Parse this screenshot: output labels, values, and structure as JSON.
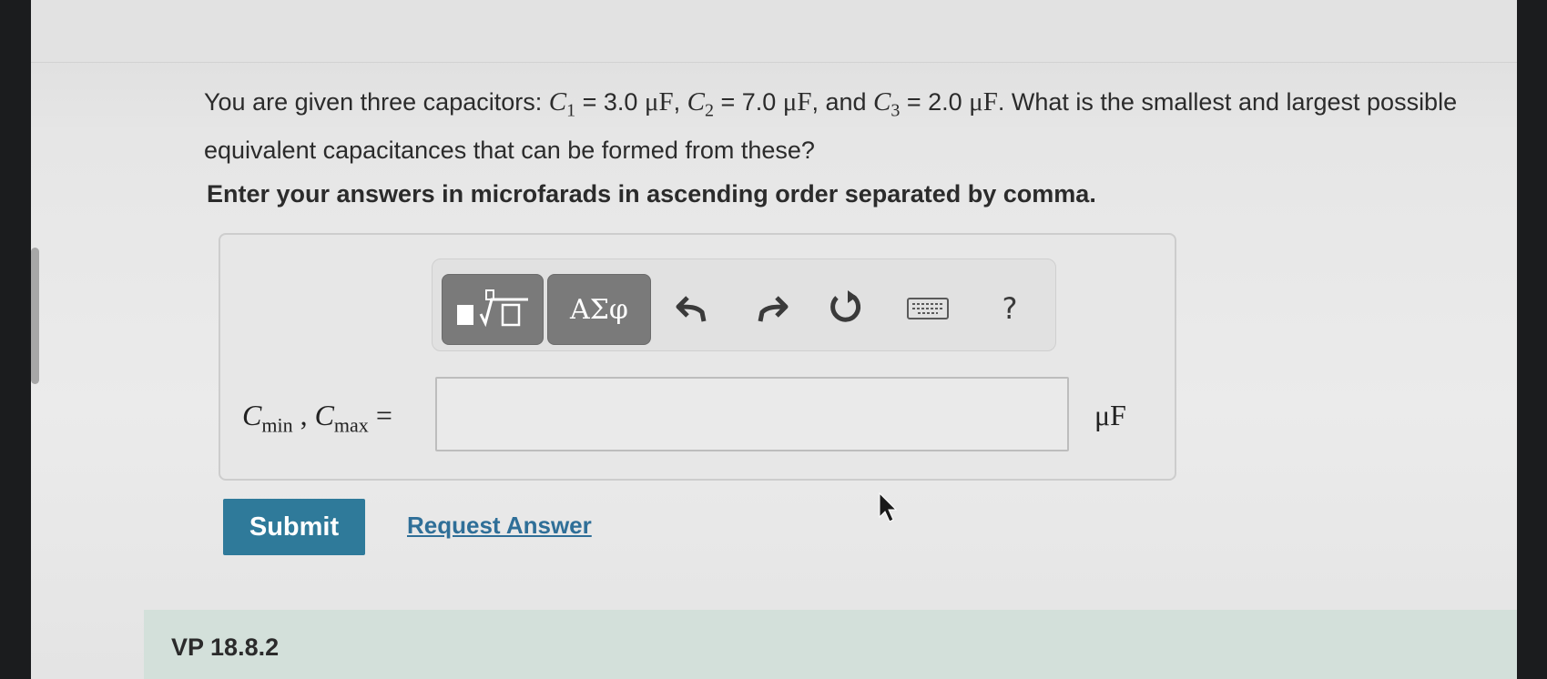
{
  "question": {
    "text_intro": "You are given three capacitors: ",
    "c1_sym": "C",
    "c1_sub": "1",
    "c1_eq": " = 3.0 ",
    "c1_unit": "μF",
    "sep1": ", ",
    "c2_sym": "C",
    "c2_sub": "2",
    "c2_eq": " = 7.0 ",
    "c2_unit": "μF",
    "sep2": ", and ",
    "c3_sym": "C",
    "c3_sub": "3",
    "c3_eq": " = 2.0 ",
    "c3_unit": "μF",
    "text_outro": ". What is the smallest and largest possible equivalent capacitances that can be formed from these?"
  },
  "instructions": "Enter your answers in microfarads in ascending order separated by comma.",
  "toolbar": {
    "templates_icon": "templates-icon",
    "symbols_label": "ΑΣφ",
    "undo_icon": "undo-icon",
    "redo_icon": "redo-icon",
    "reset_icon": "reset-icon",
    "keyboard_icon": "keyboard-icon",
    "help_label": "?"
  },
  "answer": {
    "label_c": "C",
    "label_min": "min",
    "label_sep": " , ",
    "label_c2": "C",
    "label_max": "max",
    "label_eq": " =",
    "value": "",
    "unit": "μF"
  },
  "actions": {
    "submit_label": "Submit",
    "request_label": "Request Answer"
  },
  "next_section": {
    "label": "VP 18.8.2"
  },
  "colors": {
    "submit_bg": "#2f7a9a",
    "link": "#2f6f98",
    "vp_bg": "#d3e0da"
  }
}
